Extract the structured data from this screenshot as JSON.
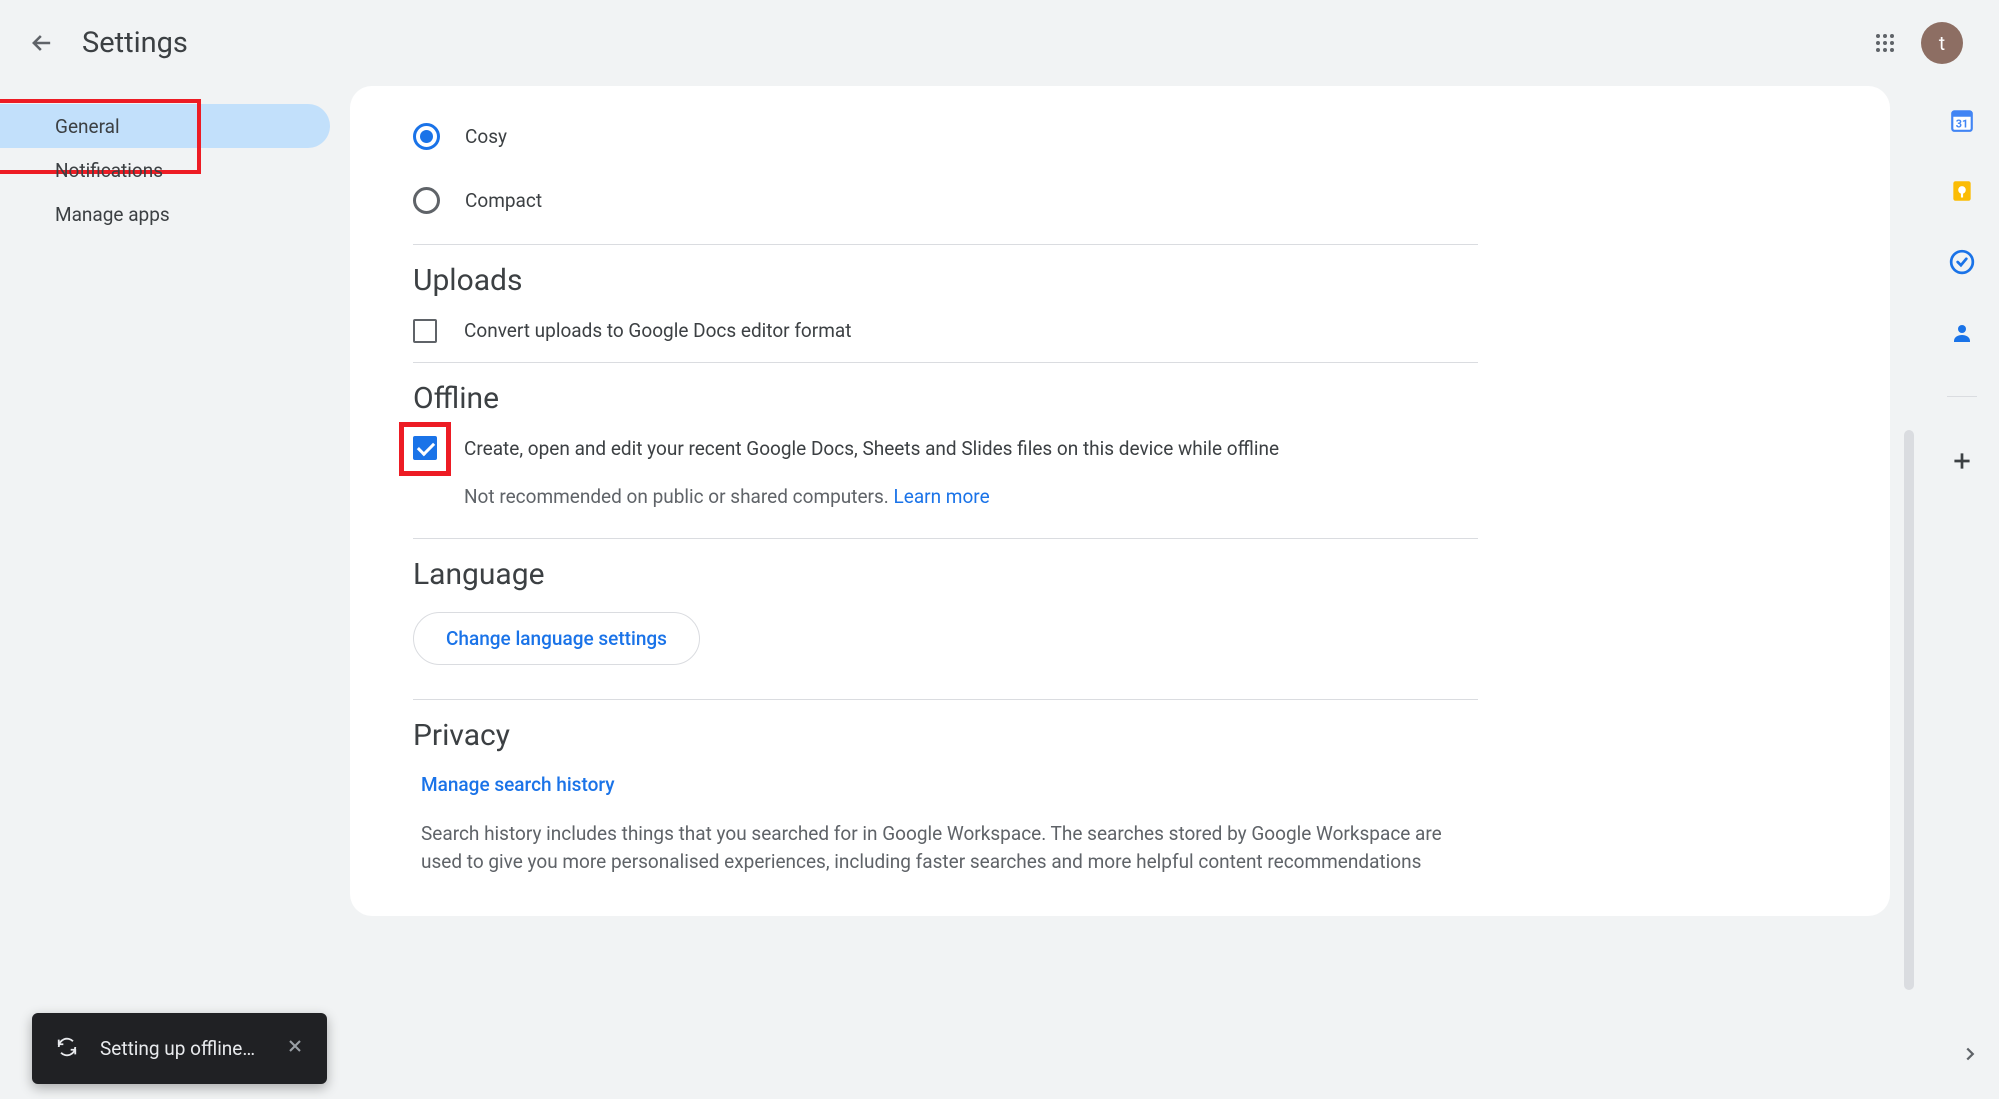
{
  "header": {
    "title": "Settings",
    "avatar_letter": "t"
  },
  "sidebar": {
    "items": [
      {
        "label": "General",
        "active": true
      },
      {
        "label": "Notifications",
        "active": false
      },
      {
        "label": "Manage apps",
        "active": false
      }
    ]
  },
  "density": {
    "cosy": "Cosy",
    "compact": "Compact"
  },
  "uploads": {
    "title": "Uploads",
    "convert": "Convert uploads to Google Docs editor format"
  },
  "offline": {
    "title": "Offline",
    "main": "Create, open and edit your recent Google Docs, Sheets and Slides files on this device while offline",
    "sub": "Not recommended on public or shared computers. ",
    "learn_more": "Learn more"
  },
  "language": {
    "title": "Language",
    "button": "Change language settings"
  },
  "privacy": {
    "title": "Privacy",
    "manage": "Manage search history",
    "desc": "Search history includes things that you searched for in Google Workspace. The searches stored by Google Workspace are used to give you more personalised experiences, including faster searches and more helpful content recommendations"
  },
  "toast": {
    "text": "Setting up offline…"
  }
}
